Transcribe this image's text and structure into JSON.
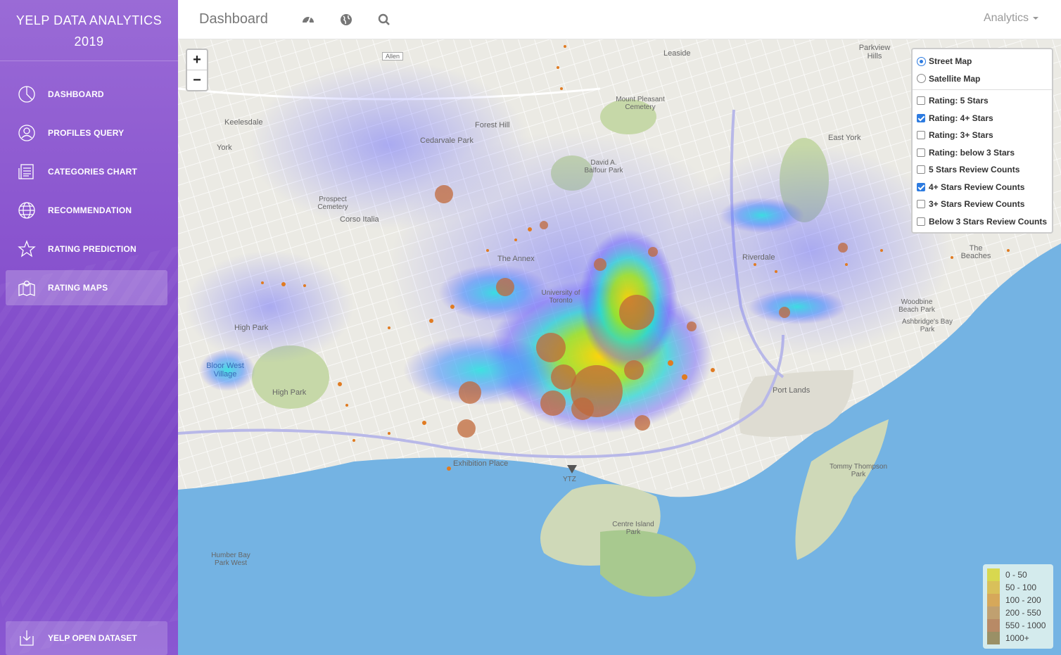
{
  "app": {
    "title_line1": "YELP DATA ANALYTICS",
    "title_line2": "2019"
  },
  "sidebar": {
    "items": [
      {
        "label": "DASHBOARD",
        "icon": "dashboard-pie-icon"
      },
      {
        "label": "PROFILES QUERY",
        "icon": "user-icon"
      },
      {
        "label": "CATEGORIES CHART",
        "icon": "newspaper-icon"
      },
      {
        "label": "RECOMMENDATION",
        "icon": "globe-icon"
      },
      {
        "label": "RATING PREDICTION",
        "icon": "star-icon"
      },
      {
        "label": "RATING MAPS",
        "icon": "map-icon"
      }
    ],
    "active_index": 5,
    "bottom_item": {
      "label": "YELP OPEN DATASET",
      "icon": "download-icon"
    }
  },
  "topbar": {
    "title": "Dashboard",
    "icons": [
      "speedometer-icon",
      "globe-icon",
      "search-icon"
    ],
    "right_menu": "Analytics"
  },
  "map": {
    "zoom_in": "+",
    "zoom_out": "−",
    "base_layers": [
      {
        "label": "Street Map",
        "selected": true
      },
      {
        "label": "Satellite Map",
        "selected": false
      }
    ],
    "overlays": [
      {
        "label": "Rating: 5 Stars",
        "checked": false
      },
      {
        "label": "Rating: 4+ Stars",
        "checked": true
      },
      {
        "label": "Rating: 3+ Stars",
        "checked": false
      },
      {
        "label": "Rating: below 3 Stars",
        "checked": false
      },
      {
        "label": "5 Stars Review Counts",
        "checked": false
      },
      {
        "label": "4+ Stars Review Counts",
        "checked": true
      },
      {
        "label": "3+ Stars Review Counts",
        "checked": false
      },
      {
        "label": "Below 3 Stars Review Counts",
        "checked": false
      }
    ],
    "legend": [
      {
        "label": "0 - 50",
        "color": "#d8d84f"
      },
      {
        "label": "50 - 100",
        "color": "#d9c05a"
      },
      {
        "label": "100 - 200",
        "color": "#d6a85a"
      },
      {
        "label": "200 - 550",
        "color": "#c0a070"
      },
      {
        "label": "550 - 1000",
        "color": "#b88a66"
      },
      {
        "label": "1000+",
        "color": "#9a9066"
      }
    ],
    "place_labels": [
      "Allen",
      "Leaside",
      "Parkview Hills",
      "Mount Pleasant Cemetery",
      "Keelesdale",
      "Forest Hill",
      "York",
      "Cedarvale Park",
      "David A. Balfour Park",
      "East York",
      "Prospect Cemetery",
      "Corso Italia",
      "The Annex",
      "Riverdale",
      "The Beaches",
      "University of Toronto",
      "High Park",
      "Woodbine Beach Park",
      "Ashbridge's Bay Park",
      "Bloor West Village",
      "High Park",
      "Port Lands",
      "Exhibition Place",
      "Tommy Thompson Park",
      "YTZ",
      "Centre Island Park",
      "Humber Bay Park West"
    ]
  },
  "colors": {
    "sidebar_accent": "#8a55cf",
    "water": "#74b3e3",
    "checkbox_accent": "#2d7be0"
  }
}
